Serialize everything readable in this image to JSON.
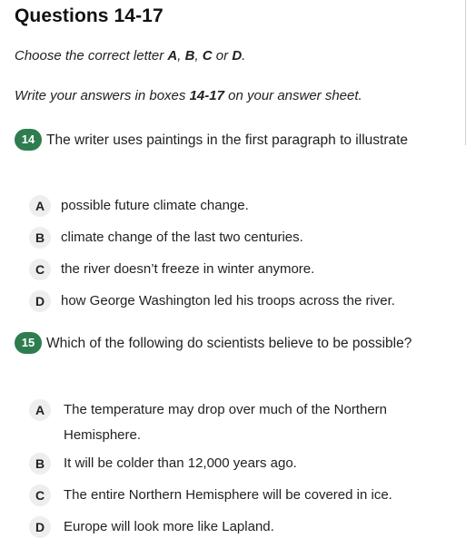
{
  "heading": "Questions 14-17",
  "instruction1": {
    "pre": "Choose the correct letter ",
    "a": "A",
    "c1": ", ",
    "b": "B",
    "c2": ", ",
    "c": "C",
    "or": " or ",
    "d": "D",
    "end": "."
  },
  "instruction2": {
    "pre": "Write your answers in boxes ",
    "range": "14-17",
    "post": " on your answer sheet."
  },
  "questions": [
    {
      "number": "14",
      "text": "The writer uses paintings in the first paragraph to illustrate",
      "options": [
        {
          "letter": "A",
          "text": "possible future climate change."
        },
        {
          "letter": "B",
          "text": "climate change of the last two centuries."
        },
        {
          "letter": "C",
          "text": "the river doesn’t freeze in winter anymore."
        },
        {
          "letter": "D",
          "text": "how George Washington led his troops across the river."
        }
      ]
    },
    {
      "number": "15",
      "text": "Which of the following do scientists believe to be possible?",
      "options": [
        {
          "letter": "A",
          "text": "The temperature may drop over much of the Northern Hemisphere."
        },
        {
          "letter": "B",
          "text": "It will be colder than 12,000 years ago."
        },
        {
          "letter": "C",
          "text": "The entire Northern Hemisphere will be covered in ice."
        },
        {
          "letter": "D",
          "text": "Europe will look more like Lapland."
        }
      ]
    }
  ],
  "colors": {
    "badge": "#2e7d4f",
    "letter_bg": "#eeeeee"
  }
}
